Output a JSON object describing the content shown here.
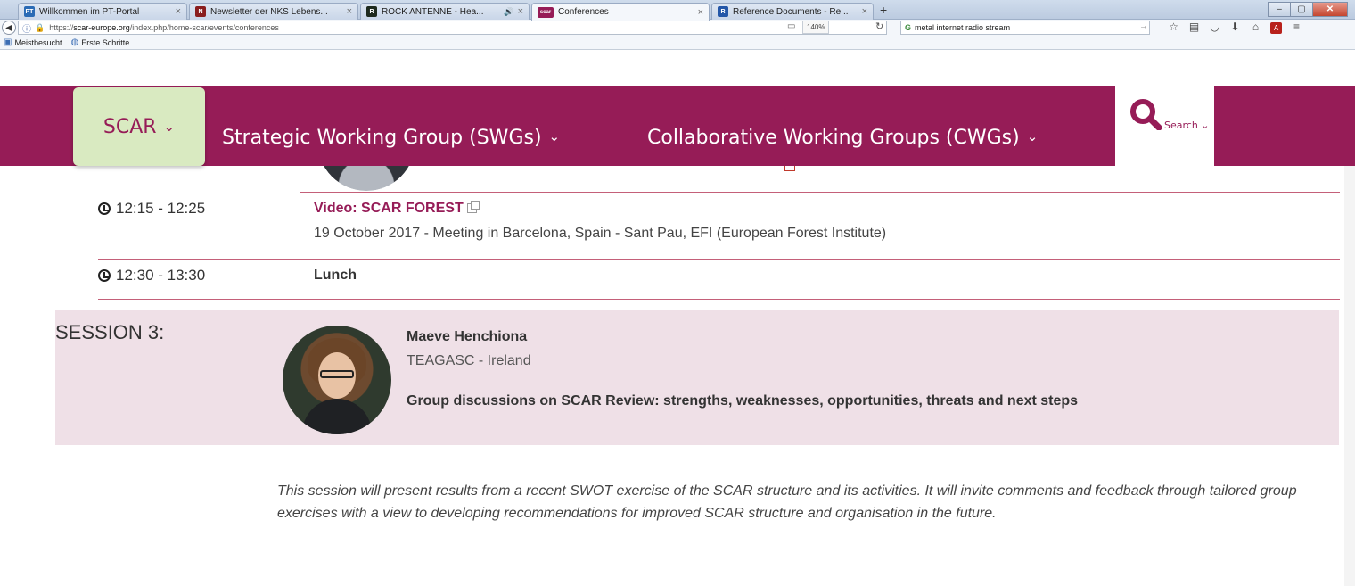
{
  "browser": {
    "tabs": [
      {
        "title": "Willkommen im PT-Portal",
        "icon_label": "PT",
        "icon_color": "#2a6bb5"
      },
      {
        "title": "Newsletter der NKS Lebens...",
        "icon_label": "N",
        "icon_color": "#8a1e1e"
      },
      {
        "title": "ROCK ANTENNE - Hea...",
        "icon_label": "R",
        "icon_color": "#1e2a1e"
      },
      {
        "title": "Conferences",
        "icon_label": "scar",
        "icon_color": "#961c57"
      },
      {
        "title": "Reference Documents - Re...",
        "icon_label": "R",
        "icon_color": "#2457a8"
      }
    ],
    "new_tab_label": "+",
    "url_prefix": "https://",
    "url_domain": "scar-europe.org",
    "url_path": "/index.php/home-scar/events/conferences",
    "zoom": "140%",
    "search_query": "metal internet radio stream",
    "bookmarks": [
      "Meistbesucht",
      "Erste Schritte"
    ]
  },
  "site_nav": {
    "scar": "SCAR",
    "swg": "Strategic Working Group (SWGs)",
    "cwg": "Collaborative Working Groups (CWGs)",
    "search": "Search"
  },
  "agenda": [
    {
      "time": "12:15 - 12:25",
      "title": "Video: SCAR FOREST",
      "subtitle": "19 October 2017 - Meeting in Barcelona, Spain - Sant Pau, EFI (European Forest Institute)"
    },
    {
      "time": "12:30 - 13:30",
      "title": "Lunch"
    }
  ],
  "session": {
    "label": "SESSION 3:",
    "speaker_name": "Maeve Henchiona",
    "speaker_org": "TEAGASC - Ireland",
    "topic": "Group discussions on SCAR Review: strengths, weaknesses, opportunities, threats and next steps",
    "description": "This session will present results from a recent SWOT exercise of the SCAR structure and its activities. It will invite comments and feedback through tailored group exercises with a view to developing recommendations for improved SCAR structure and organisation in the future."
  },
  "colors": {
    "brand": "#961c57",
    "scar_menu_bg": "#d9eac1",
    "session_bg": "#efe0e7"
  }
}
